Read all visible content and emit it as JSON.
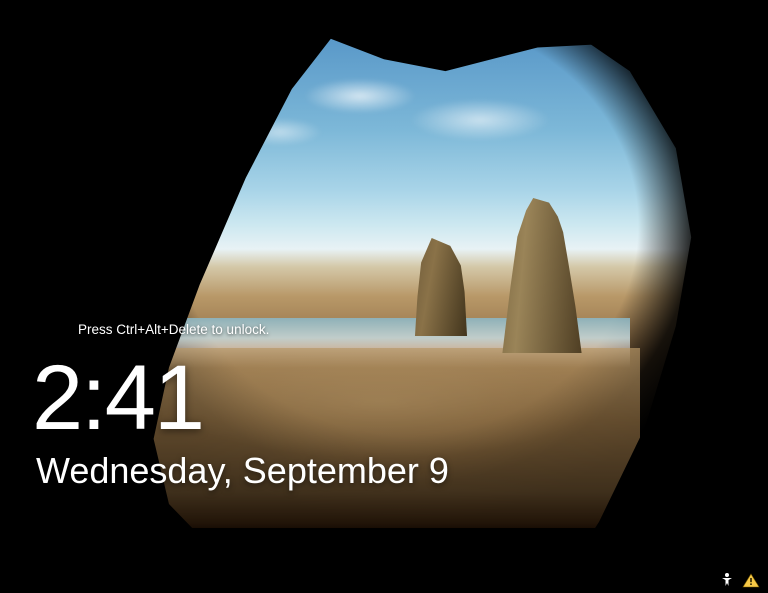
{
  "lockscreen": {
    "unlock_hint": "Press Ctrl+Alt+Delete to unlock.",
    "time": "2:41",
    "date": "Wednesday, September 9"
  },
  "tray": {
    "ease_of_access_label": "Ease of access",
    "network_warning_label": "Network warning"
  }
}
